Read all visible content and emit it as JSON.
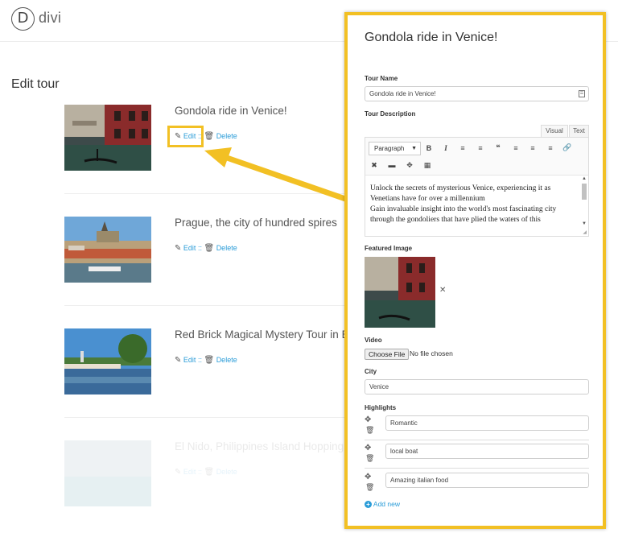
{
  "header": {
    "logo_letter": "D",
    "logo_text": "divi"
  },
  "page": {
    "title": "Edit tour"
  },
  "tours": [
    {
      "title": "Gondola ride in Venice!",
      "edit_label": "Edit",
      "separator": "::",
      "delete_label": "Delete"
    },
    {
      "title": "Prague, the city of hundred spires",
      "edit_label": "Edit",
      "separator": "::",
      "delete_label": "Delete"
    },
    {
      "title": "Red Brick Magical Mystery Tour in E",
      "edit_label": "Edit",
      "separator": "::",
      "delete_label": "Delete"
    },
    {
      "title": "El Nido, Philippines Island Hopping",
      "edit_label": "Edit",
      "separator": "::",
      "delete_label": "Delete"
    }
  ],
  "panel": {
    "title": "Gondola ride in Venice!",
    "tour_name_label": "Tour Name",
    "tour_name_value": "Gondola ride in Venice!",
    "tour_description_label": "Tour Description",
    "tab_visual": "Visual",
    "tab_text": "Text",
    "format_select": "Paragraph",
    "description_lines": [
      "Unlock the secrets of mysterious Venice, experiencing it as",
      "Venetians have for over a millennium",
      "Gain invaluable insight into the world's most fascinating city",
      "through the gondoliers that have plied the waters of this"
    ],
    "featured_image_label": "Featured Image",
    "video_label": "Video",
    "choose_file_label": "Choose File",
    "no_file_text": "No file chosen",
    "city_label": "City",
    "city_value": "Venice",
    "highlights_label": "Highlights",
    "highlights": [
      "Romantic",
      "local boat",
      "Amazing italian food"
    ],
    "add_new_label": "Add new"
  },
  "colors": {
    "accent": "#f2c024",
    "link": "#2a9cd8"
  },
  "icons": [
    "edit-icon",
    "trash-icon",
    "move-icon",
    "close-icon",
    "plus-circle-icon",
    "bold-icon",
    "italic-icon",
    "bullet-list-icon",
    "numbered-list-icon",
    "blockquote-icon",
    "align-left-icon",
    "align-center-icon",
    "align-right-icon",
    "link-icon",
    "unlink-icon",
    "horizontal-rule-icon",
    "fullscreen-icon",
    "kitchen-sink-icon"
  ]
}
